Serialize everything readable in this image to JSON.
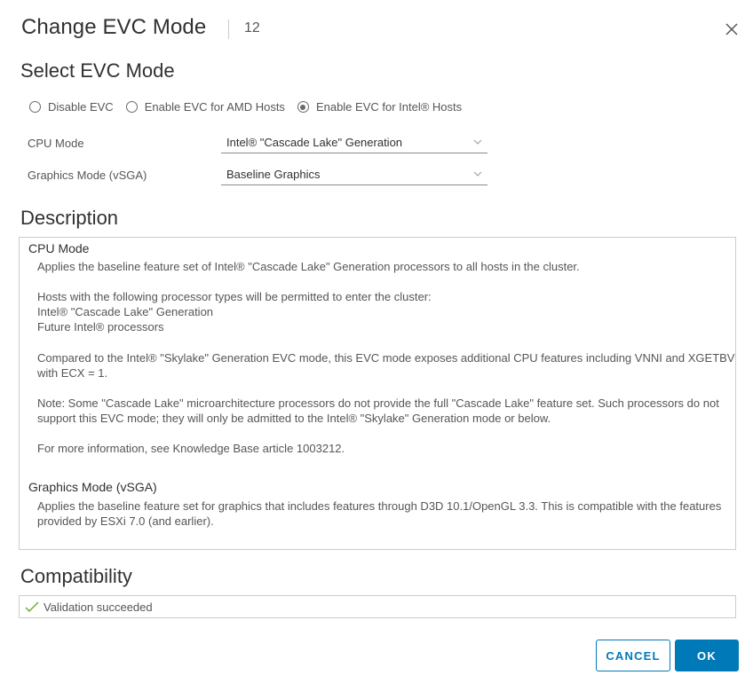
{
  "dialog": {
    "title": "Change EVC Mode",
    "count": "12"
  },
  "select_section": {
    "heading": "Select EVC Mode",
    "radios": [
      {
        "label": "Disable EVC",
        "checked": false
      },
      {
        "label": "Enable EVC for AMD Hosts",
        "checked": false
      },
      {
        "label": "Enable EVC for Intel® Hosts",
        "checked": true
      }
    ],
    "cpu_mode": {
      "label": "CPU Mode",
      "value": "Intel® \"Cascade Lake\" Generation"
    },
    "graphics_mode": {
      "label": "Graphics Mode (vSGA)",
      "value": "Baseline Graphics"
    }
  },
  "description": {
    "heading": "Description",
    "cpu_heading": "CPU Mode",
    "cpu_p1": "Applies the baseline feature set of Intel® \"Cascade Lake\" Generation processors to all hosts in the cluster.",
    "cpu_p2": "Hosts with the following processor types will be permitted to enter the cluster:\nIntel® \"Cascade Lake\" Generation\nFuture Intel® processors",
    "cpu_p3": "Compared to the Intel® \"Skylake\" Generation EVC mode, this EVC mode exposes additional CPU features including VNNI and XGETBV with ECX = 1.",
    "cpu_p4": "Note: Some \"Cascade Lake\" microarchitecture processors do not provide the full \"Cascade Lake\" feature set. Such processors do not support this EVC mode; they will only be admitted to the Intel® \"Skylake\" Generation mode or below.",
    "cpu_p5": "For more information, see Knowledge Base article 1003212.",
    "graphics_heading": "Graphics Mode (vSGA)",
    "graphics_p1": "Applies the baseline feature set for graphics that includes features through D3D 10.1/OpenGL 3.3. This is compatible with the features provided by ESXi 7.0 (and earlier)."
  },
  "compatibility": {
    "heading": "Compatibility",
    "status": "Validation succeeded",
    "status_icon": "check-icon",
    "status_color": "#62a420"
  },
  "buttons": {
    "cancel": "CANCEL",
    "ok": "OK"
  },
  "colors": {
    "primary": "#0079b8"
  }
}
